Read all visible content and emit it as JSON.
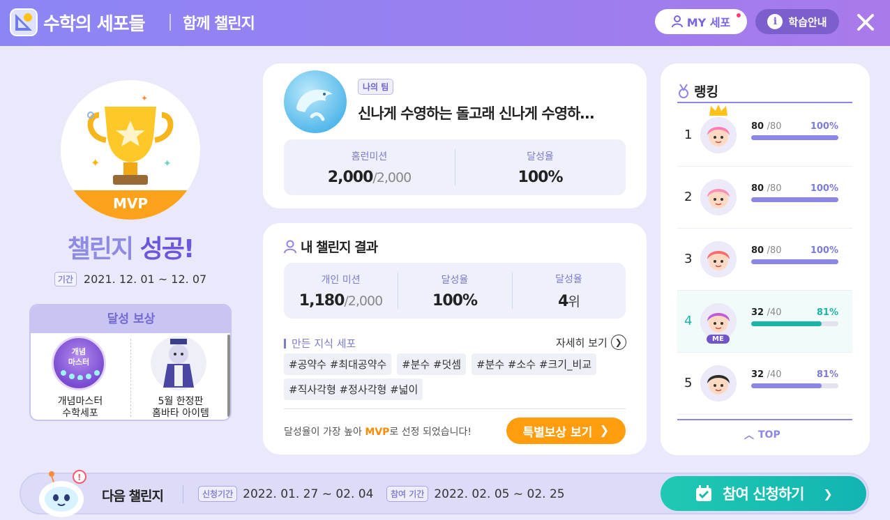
{
  "header": {
    "app_title": "수학의 세포들",
    "subtitle": "함께 챌린지",
    "my_button": "MY 세포",
    "guide_button": "학습안내",
    "close_icon": "close-icon"
  },
  "left": {
    "mvp_label": "MVP",
    "success_a": "챌린지",
    "success_b": "성공!",
    "period_tag": "기간",
    "period": "2021. 12. 01 ~ 12. 07",
    "reward_title": "달성 보상",
    "rewards": [
      {
        "badge_text": "개념\n마스터",
        "label_1": "개념마스터",
        "label_2": "수학세포"
      },
      {
        "label_1": "5월 한정판",
        "label_2": "홈바타 아이템"
      }
    ]
  },
  "team": {
    "tag": "나의 팀",
    "name": "신나게 수영하는 돌고래 신나게 수영하…",
    "stats": [
      {
        "label": "홈런미션",
        "value": "2,000",
        "sub": "/2,000"
      },
      {
        "label": "달성율",
        "value": "100%"
      }
    ]
  },
  "result": {
    "title": "내 챌린지 결과",
    "stats": [
      {
        "label": "개인 미션",
        "value": "1,180",
        "sub": "/2,000"
      },
      {
        "label": "달성율",
        "value": "100%"
      },
      {
        "label": "달성율",
        "value": "4",
        "unit": "위"
      }
    ],
    "cells_title": "만든 지식 세포",
    "detail_link": "자세히 보기",
    "hashtags": [
      "#공약수 #최대공약수",
      "#분수 #덧셈",
      "#분수 #소수 #크기_비교",
      "#직사각형 #정사각형 #넓이"
    ],
    "note_before": "달성율이 가장 높아 ",
    "note_mvp": "MVP",
    "note_after": "로 선정 되었습니다!",
    "special_button": "특별보상 보기"
  },
  "ranking": {
    "title": "랭킹",
    "rows": [
      {
        "rank": "1",
        "score": "80",
        "max": "/80",
        "pct": "100%",
        "ratio": 1.0,
        "me": false
      },
      {
        "rank": "2",
        "score": "80",
        "max": "/80",
        "pct": "100%",
        "ratio": 1.0,
        "me": false
      },
      {
        "rank": "3",
        "score": "80",
        "max": "/80",
        "pct": "100%",
        "ratio": 1.0,
        "me": false
      },
      {
        "rank": "4",
        "score": "32",
        "max": "/40",
        "pct": "81%",
        "ratio": 0.81,
        "me": true
      },
      {
        "rank": "5",
        "score": "32",
        "max": "/40",
        "pct": "81%",
        "ratio": 0.81,
        "me": false
      }
    ],
    "me_badge": "ME",
    "top_button": "TOP"
  },
  "bottom": {
    "next_label": "다음 챌린지",
    "apply_tag": "신청기간",
    "apply_period": "2022. 01. 27 ~ 02. 04",
    "join_tag": "참여 기간",
    "join_period": "2022. 02. 05 ~ 02. 25",
    "join_button": "참여 신청하기"
  },
  "colors": {
    "accent": "#8c86e6",
    "orange": "#ff9d0e",
    "teal": "#1bb5a8"
  }
}
